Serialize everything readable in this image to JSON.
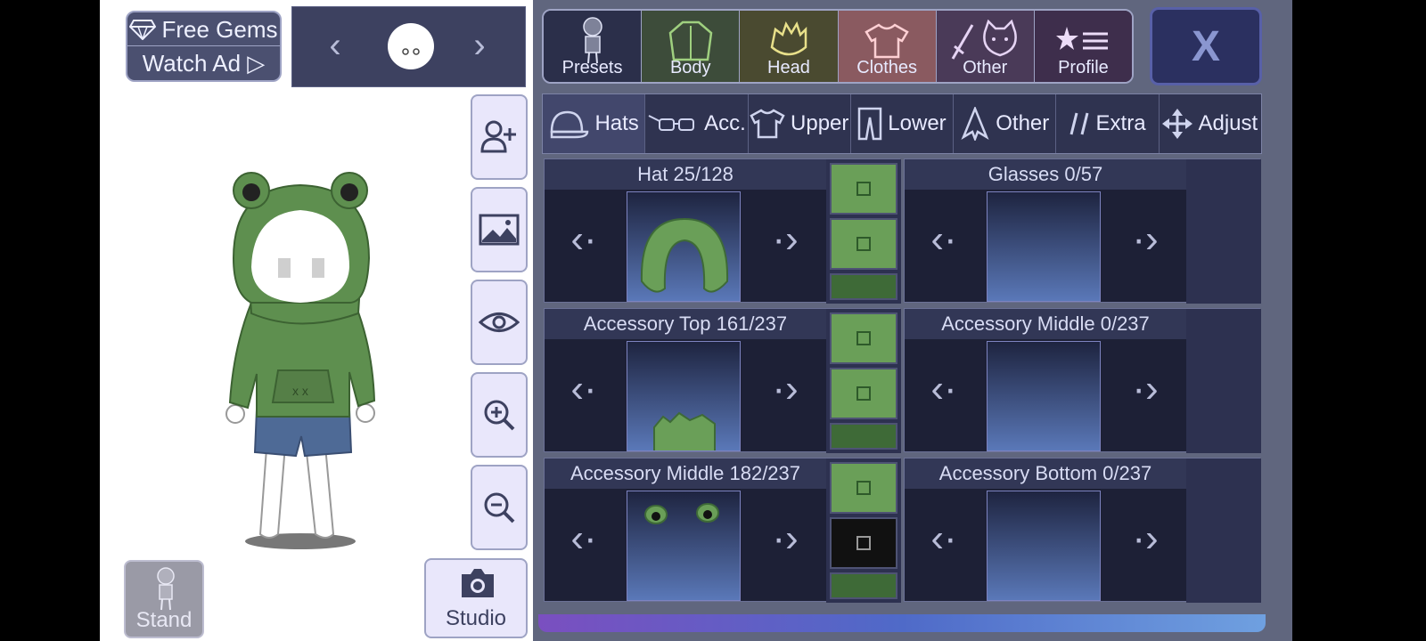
{
  "left": {
    "gems": {
      "free_label": "Free Gems",
      "watch_label": "Watch Ad ▷"
    },
    "char_nav": {
      "prev": "‹",
      "next": "›"
    },
    "stand_label": "Stand",
    "studio_label": "Studio"
  },
  "top_tabs": [
    {
      "label": "Presets",
      "icon": "preset-figure-icon"
    },
    {
      "label": "Body",
      "icon": "jacket-icon"
    },
    {
      "label": "Head",
      "icon": "hair-icon"
    },
    {
      "label": "Clothes",
      "icon": "shirt-icon"
    },
    {
      "label": "Other",
      "icon": "sword-cat-icon"
    },
    {
      "label": "Profile",
      "icon": "star-list-icon"
    }
  ],
  "close_label": "X",
  "sub_tabs": [
    {
      "label": "Hats",
      "icon": "cap-icon"
    },
    {
      "label": "Acc.",
      "icon": "glasses-icon"
    },
    {
      "label": "Upper",
      "icon": "tshirt-icon"
    },
    {
      "label": "Lower",
      "icon": "pants-icon"
    },
    {
      "label": "Other",
      "icon": "cape-icon"
    },
    {
      "label": "Extra",
      "icon": "slash-icon"
    },
    {
      "label": "Adjust",
      "icon": "move-icon"
    }
  ],
  "slots": [
    {
      "title": "Hat 25/128"
    },
    {
      "title": "Glasses 0/57"
    },
    {
      "title": "Accessory Top 161/237"
    },
    {
      "title": "Accessory Middle 0/237"
    },
    {
      "title": "Accessory Middle 182/237"
    },
    {
      "title": "Accessory Bottom 0/237"
    }
  ],
  "arrows": {
    "prev": "‹·",
    "next": "·›"
  },
  "colors": {
    "green": "#6a9f58",
    "dark_green": "#3e6a37",
    "panel": "#2b2f4a",
    "clothes_tab": "#8a5a60"
  }
}
